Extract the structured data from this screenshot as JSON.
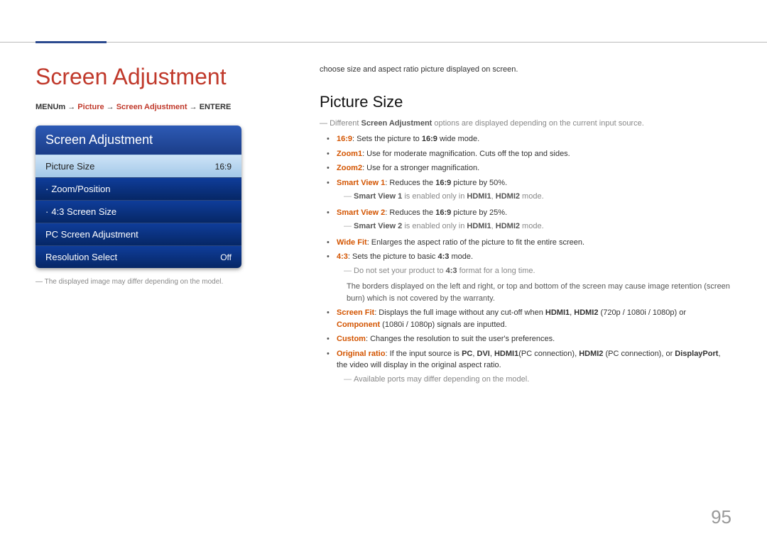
{
  "header": {
    "title": "Screen Adjustment"
  },
  "breadcrumb": {
    "a": "MENUm",
    "arr": "→",
    "b": "Picture",
    "c": "Screen Adjustment",
    "d": "ENTERE"
  },
  "menu": {
    "title": "Screen Adjustment",
    "items": [
      {
        "label": "Picture Size",
        "value": "16:9"
      },
      {
        "label": "Zoom/Position",
        "value": ""
      },
      {
        "label": "4:3 Screen Size",
        "value": ""
      },
      {
        "label": "PC Screen Adjustment",
        "value": ""
      },
      {
        "label": "Resolution Select",
        "value": "Off"
      }
    ]
  },
  "caption": "The displayed image may differ depending on the model.",
  "intro": "choose size and aspect ratio picture displayed on screen.",
  "section_title": "Picture Size",
  "sub_a": "Different ",
  "sub_b": "Screen Adjustment",
  "sub_c": " options are displayed depending on the current input source.",
  "b1": {
    "k": "16:9",
    "t": ": Sets the picture to ",
    "k2": "16:9",
    "t2": " wide mode."
  },
  "b2": {
    "k": "Zoom1",
    "t": ": Use for moderate magnification. Cuts off the top and sides."
  },
  "b3": {
    "k": "Zoom2",
    "t": ": Use for a stronger magnification."
  },
  "b4": {
    "k": "Smart View 1",
    "t": ": Reduces the ",
    "k2": "16:9",
    "t2": " picture by 50%."
  },
  "n4": {
    "a": "Smart View 1",
    "b": " is enabled only in ",
    "c": "HDMI1",
    "d": ", ",
    "e": "HDMI2",
    "f": " mode."
  },
  "b5": {
    "k": "Smart View 2",
    "t": ": Reduces the ",
    "k2": "16:9",
    "t2": " picture by 25%."
  },
  "n5": {
    "a": "Smart View 2",
    "b": " is enabled only in ",
    "c": "HDMI1",
    "d": ", ",
    "e": "HDMI2",
    "f": " mode."
  },
  "b6": {
    "k": "Wide Fit",
    "t": ": Enlarges the aspect ratio of the picture to fit the entire screen."
  },
  "b7": {
    "k": "4:3",
    "t": ": Sets the picture to basic ",
    "k2": "4:3",
    "t2": " mode."
  },
  "n7a": {
    "a": "Do not set your product to ",
    "b": "4:3",
    "c": " format for a long time."
  },
  "n7b": "The borders displayed on the left and right, or top and bottom of the screen may cause image retention (screen burn) which is not covered by the warranty.",
  "b8": {
    "k": "Screen Fit",
    "t1": ": Displays the full image without any cut-off when ",
    "h1": "HDMI1",
    "c1": ", ",
    "h2": "HDMI2",
    "t2": " (720p / 1080i / 1080p) or ",
    "cp": "Component",
    "t3": " (1080i / 1080p) signals are inputted."
  },
  "b9": {
    "k": "Custom",
    "t": ": Changes the resolution to suit the user's preferences."
  },
  "b10": {
    "k": "Original ratio",
    "t1": ": If the input source is ",
    "pc": "PC",
    "c1": ", ",
    "dvi": "DVI",
    "c2": ", ",
    "h1": "HDMI1",
    "t2": "(PC connection), ",
    "h2": "HDMI2",
    "t3": " (PC connection), or ",
    "dp": "DisplayPort",
    "t4": ", the video will display in the original aspect ratio."
  },
  "n10": "Available ports may differ depending on the model.",
  "page_number": "95"
}
